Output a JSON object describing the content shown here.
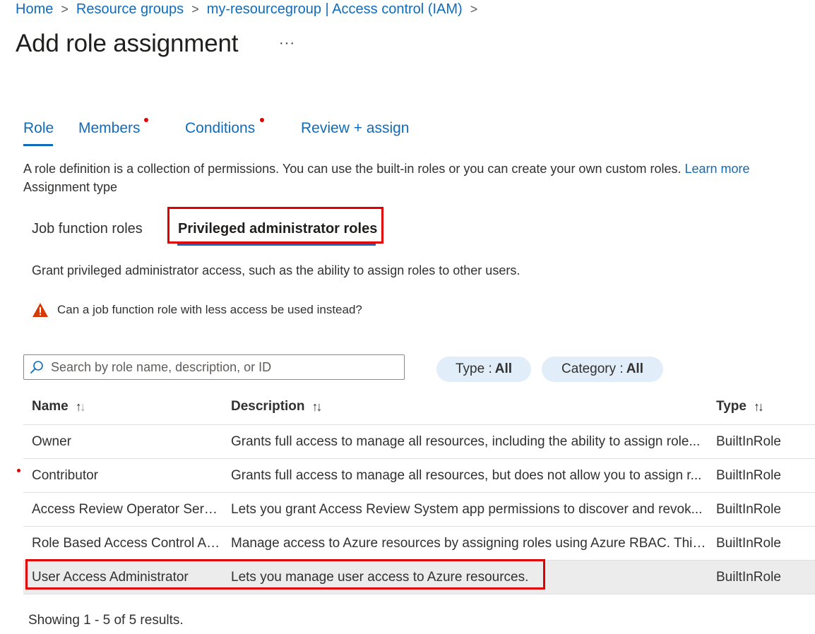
{
  "breadcrumb": {
    "items": [
      "Home",
      "Resource groups",
      "my-resourcegroup | Access control (IAM)"
    ],
    "separator": ">"
  },
  "page": {
    "title": "Add role assignment",
    "more": "···"
  },
  "tabs": [
    {
      "label": "Role",
      "active": true,
      "required_dot": false
    },
    {
      "label": "Members",
      "active": false,
      "required_dot": true
    },
    {
      "label": "Conditions",
      "active": false,
      "required_dot": true
    },
    {
      "label": "Review + assign",
      "active": false,
      "required_dot": false
    }
  ],
  "intro": {
    "text": "A role definition is a collection of permissions. You can use the built-in roles or you can create your own custom roles.",
    "learn_more": "Learn more"
  },
  "assignment_type": {
    "label": "Assignment type",
    "tabs": [
      "Job function roles",
      "Privileged administrator roles"
    ],
    "selected": "Privileged administrator roles"
  },
  "description": "Grant privileged administrator access, such as the ability to assign roles to other users.",
  "warning": "Can a job function role with less access be used instead?",
  "search": {
    "placeholder": "Search by role name, description, or ID",
    "value": ""
  },
  "filters": [
    {
      "label": "Type :",
      "value": "All"
    },
    {
      "label": "Category :",
      "value": "All"
    }
  ],
  "table": {
    "columns": [
      "Name",
      "Description",
      "Type"
    ],
    "rows": [
      {
        "name": "Owner",
        "description": "Grants full access to manage all resources, including the ability to assign role...",
        "type": "BuiltInRole"
      },
      {
        "name": "Contributor",
        "description": "Grants full access to manage all resources, but does not allow you to assign r...",
        "type": "BuiltInRole"
      },
      {
        "name": "Access Review Operator Servi...",
        "description": "Lets you grant Access Review System app permissions to discover and revok...",
        "type": "BuiltInRole"
      },
      {
        "name": "Role Based Access Control Ad...",
        "description": "Manage access to Azure resources by assigning roles using Azure RBAC. This...",
        "type": "BuiltInRole"
      },
      {
        "name": "User Access Administrator",
        "description": "Lets you manage user access to Azure resources.",
        "type": "BuiltInRole"
      }
    ],
    "selected_index": 4
  },
  "results_text": "Showing 1 - 5 of 5 results.",
  "colors": {
    "accent": "#0f6cbd",
    "highlight": "#e00000",
    "warning": "#d83b01",
    "pill": "#e1eefa"
  }
}
